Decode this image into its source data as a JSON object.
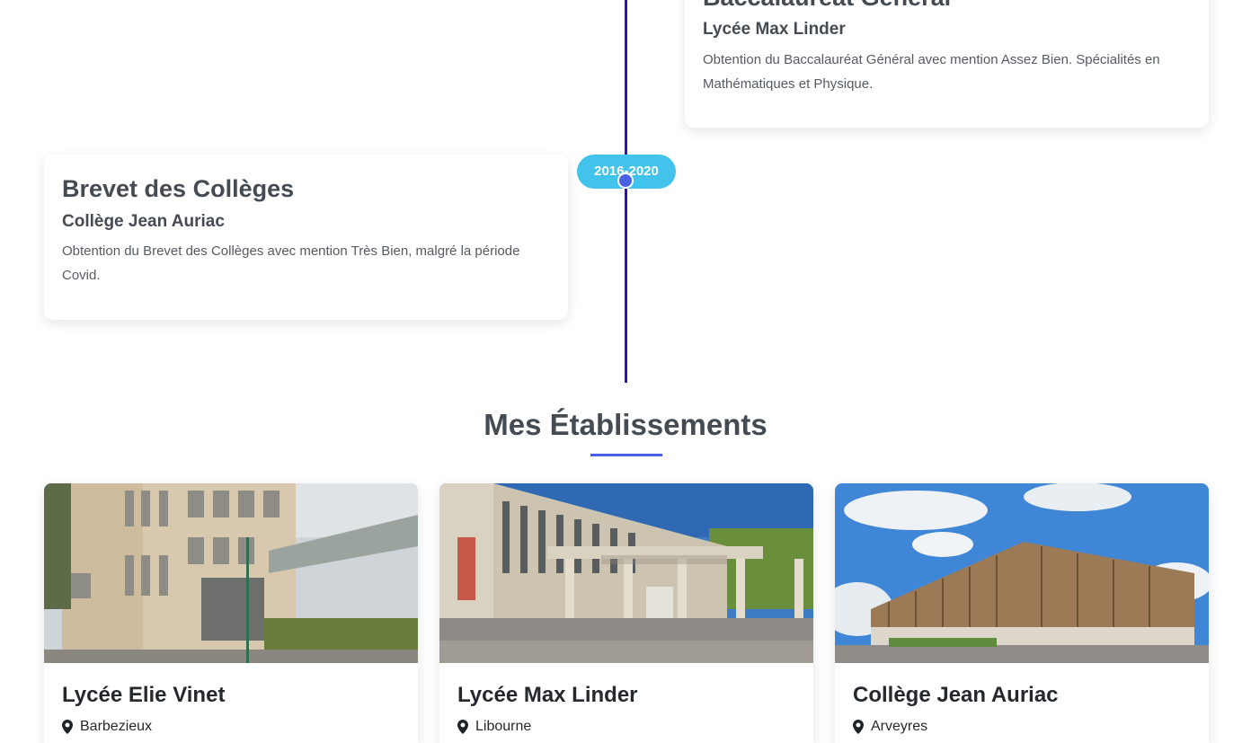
{
  "timeline": {
    "items": [
      {
        "title": "Baccalauréat Général",
        "school": "Lycée Max Linder",
        "description": "Obtention du Baccalauréat Général avec mention Assez Bien. Spécialités en Mathématiques et Physique."
      },
      {
        "date": "2016-2020",
        "title": "Brevet des Collèges",
        "school": "Collège Jean Auriac",
        "description": "Obtention du Brevet des Collèges avec mention Très Bien, malgré la période Covid."
      }
    ]
  },
  "establishments": {
    "title": "Mes Établissements",
    "items": [
      {
        "name": "Lycée Elie Vinet",
        "location": "Barbezieux",
        "icon": "map-marker-icon"
      },
      {
        "name": "Lycée Max Linder",
        "location": "Libourne",
        "icon": "map-marker-icon"
      },
      {
        "name": "Collège Jean Auriac",
        "location": "Arveyres",
        "icon": "map-marker-icon"
      }
    ]
  },
  "colors": {
    "timeline_line": "#3b14a6",
    "date_pill": "#41c3eb",
    "accent": "#4760e6",
    "text": "#454b52"
  }
}
